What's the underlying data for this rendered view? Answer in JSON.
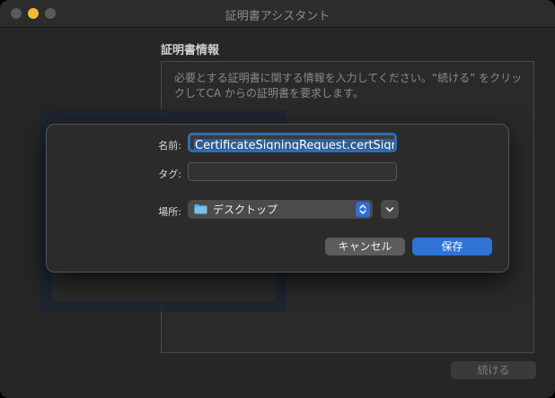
{
  "window": {
    "title": "証明書アシスタント"
  },
  "assistant": {
    "section_title": "証明書情報",
    "description": "必要とする証明書に関する情報を入力してください。“続ける” をクリックしてCA からの証明書を要求します。",
    "continue_label": "続ける"
  },
  "save_sheet": {
    "name_label": "名前:",
    "name_value": "CertificateSigningRequest.certSigni",
    "tag_label": "タグ:",
    "tag_value": "",
    "where_label": "場所:",
    "where_value": "デスクトップ",
    "cancel_label": "キャンセル",
    "save_label": "保存"
  },
  "icons": {
    "folder": "folder-icon",
    "stepper": "up-down-chevron-icon",
    "expand": "chevron-down-icon"
  },
  "colors": {
    "accent": "#2f73d4",
    "minimize": "#f6b73b"
  }
}
